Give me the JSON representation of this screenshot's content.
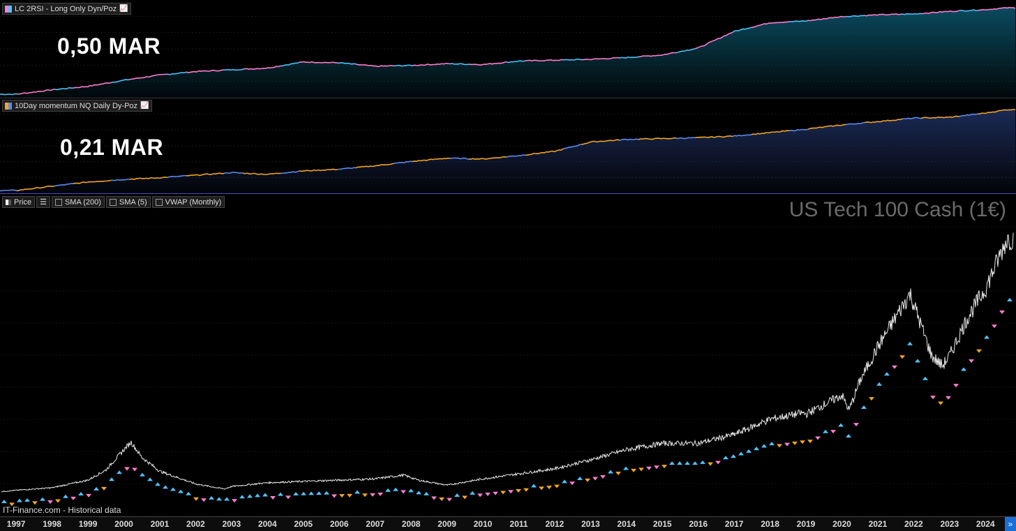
{
  "panes": {
    "top": {
      "label": "LC 2RSI - Long Only Dyn/Poz",
      "annotation": "0,50 MAR",
      "swatch_colors": [
        "#ff7fd0",
        "#4fc3ff"
      ],
      "fill_color": "#0a4a5e"
    },
    "middle": {
      "label": "10Day momentum NQ Daily Dy-Poz",
      "annotation": "0,21 MAR",
      "swatch_colors": [
        "#f5a623",
        "#5b8def"
      ],
      "fill_color": "#1b2a55"
    },
    "price": {
      "toggles": [
        "Price",
        "SMA (200)",
        "SMA (5)",
        "VWAP (Monthly)"
      ],
      "title": "US Tech 100 Cash (1€)",
      "source": "IT-Finance.com - Historical data"
    }
  },
  "chart_data": [
    {
      "type": "area",
      "title": "LC 2RSI - Long Only Dyn/Poz",
      "annotation": "0,50 MAR",
      "x": [
        1997,
        1998,
        1999,
        2000,
        2001,
        2002,
        2003,
        2004,
        2005,
        2006,
        2007,
        2008,
        2009,
        2010,
        2011,
        2012,
        2013,
        2014,
        2015,
        2016,
        2017,
        2018,
        2019,
        2020,
        2021,
        2022,
        2023,
        2024,
        2024.6
      ],
      "series": [
        {
          "name": "LC 2RSI - Long Only Dyn/Poz",
          "values": [
            0,
            5,
            9,
            16,
            22,
            26,
            28,
            30,
            37,
            36,
            32,
            33,
            35,
            34,
            38,
            39,
            40,
            42,
            45,
            53,
            72,
            82,
            84,
            89,
            91,
            92,
            95,
            97,
            99
          ]
        }
      ],
      "ylim": [
        0,
        100
      ]
    },
    {
      "type": "area",
      "title": "10Day momentum NQ Daily Dy-Poz",
      "annotation": "0,21 MAR",
      "x": [
        1997,
        1998,
        1999,
        2000,
        2001,
        2002,
        2003,
        2004,
        2005,
        2006,
        2007,
        2008,
        2009,
        2010,
        2011,
        2012,
        2013,
        2014,
        2015,
        2016,
        2017,
        2018,
        2019,
        2020,
        2021,
        2022,
        2023,
        2024,
        2024.6
      ],
      "series": [
        {
          "name": "10Day momentum NQ Daily Dy-Poz",
          "values": [
            0,
            5,
            10,
            13,
            15,
            18,
            21,
            19,
            23,
            25,
            29,
            34,
            38,
            37,
            41,
            46,
            57,
            60,
            61,
            62,
            64,
            68,
            72,
            77,
            81,
            85,
            86,
            91,
            95
          ]
        }
      ],
      "ylim": [
        0,
        100
      ]
    },
    {
      "type": "line",
      "title": "US Tech 100 Cash (1€)",
      "x": [
        "1997",
        "1998",
        "1999",
        "2000",
        "2001",
        "2002",
        "2003",
        "2004",
        "2005",
        "2006",
        "2007",
        "2008",
        "2009",
        "2010",
        "2011",
        "2012",
        "2013",
        "2014",
        "2015",
        "2016",
        "2017",
        "2018",
        "2019",
        "2020",
        "2021",
        "2022",
        "2023",
        "2024"
      ],
      "x_numeric": [
        1996.6,
        1997,
        1998,
        1999,
        1999.5,
        2000,
        2000.2,
        2000.5,
        2001,
        2002,
        2002.8,
        2003,
        2004,
        2005,
        2006,
        2007,
        2007.8,
        2008.2,
        2009,
        2010,
        2011,
        2012,
        2013,
        2014,
        2015,
        2016,
        2017,
        2018,
        2018.9,
        2019,
        2020,
        2020.2,
        2020.5,
        2021,
        2021.9,
        2022.5,
        2022.8,
        2023,
        2023.5,
        2024,
        2024.6
      ],
      "series": [
        {
          "name": "Price",
          "values": [
            800,
            900,
            1100,
            1700,
            2500,
            4100,
            4700,
            3500,
            2400,
            1400,
            1000,
            1200,
            1500,
            1600,
            1700,
            1800,
            2100,
            1700,
            1300,
            1800,
            2200,
            2600,
            3300,
            4100,
            4600,
            4600,
            5300,
            6500,
            7000,
            6900,
            8400,
            7200,
            9500,
            12200,
            16400,
            11500,
            10700,
            11500,
            14500,
            16800,
            20700
          ]
        }
      ],
      "ylim": [
        0,
        22000
      ]
    }
  ]
}
